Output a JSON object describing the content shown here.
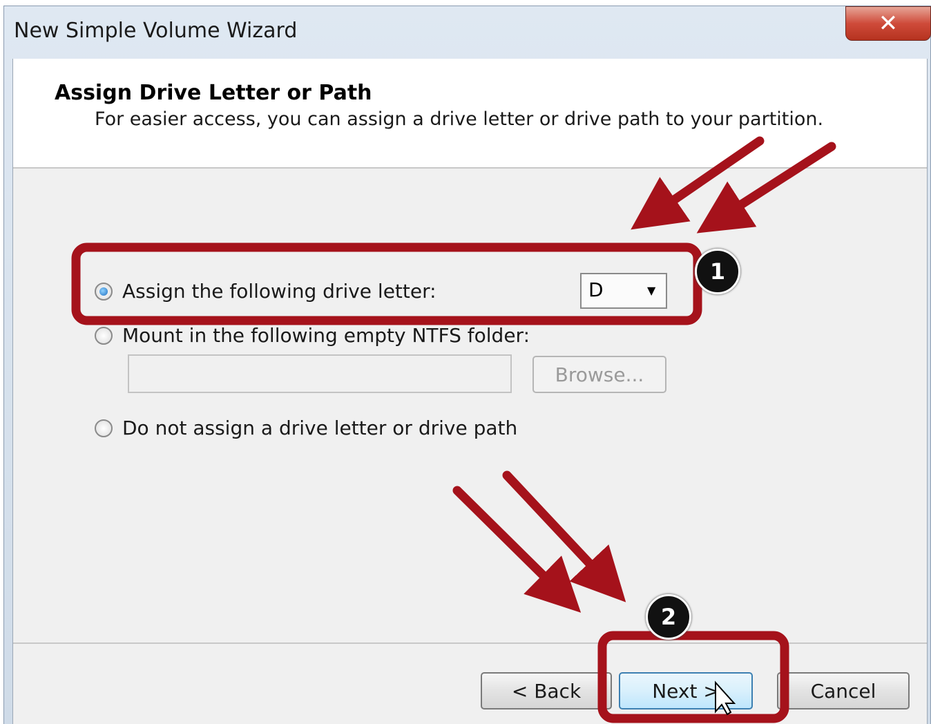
{
  "window": {
    "title": "New Simple Volume Wizard",
    "close_icon": "close-icon"
  },
  "header": {
    "title": "Assign Drive Letter or Path",
    "subtitle": "For easier access, you can assign a drive letter or drive path to your partition."
  },
  "options": {
    "assign_letter": {
      "label": "Assign the following drive letter:",
      "checked": true,
      "drive_letter": "D"
    },
    "mount_folder": {
      "label": "Mount in the following empty NTFS folder:",
      "checked": false,
      "folder_value": "",
      "browse_label": "Browse..."
    },
    "no_assign": {
      "label": "Do not assign a drive letter or drive path",
      "checked": false
    }
  },
  "buttons": {
    "back": "< Back",
    "next": "Next >",
    "cancel": "Cancel"
  },
  "annotations": {
    "step1": "1",
    "step2": "2",
    "accent_color": "#a5121b"
  }
}
